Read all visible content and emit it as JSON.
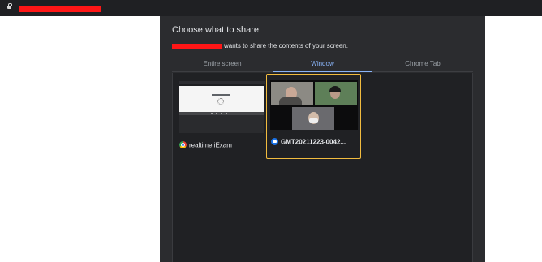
{
  "browser": {
    "lock_icon": "lock-icon"
  },
  "dialog": {
    "title": "Choose what to share",
    "subtitle": "wants to share the contents of your screen.",
    "tabs": [
      {
        "label": "Entire screen",
        "active": false
      },
      {
        "label": "Window",
        "active": true
      },
      {
        "label": "Chrome Tab",
        "active": false
      }
    ],
    "windows": [
      {
        "label": "realtime iExam",
        "icon": "chrome-icon",
        "selected": false
      },
      {
        "label": "GMT20211223-0042...",
        "icon": "meet-icon",
        "selected": true
      }
    ]
  },
  "colors": {
    "accent": "#8ab4f8",
    "selection": "#f2bc3f",
    "dialog_bg": "#2b2c2f",
    "redaction": "#ff1616"
  }
}
